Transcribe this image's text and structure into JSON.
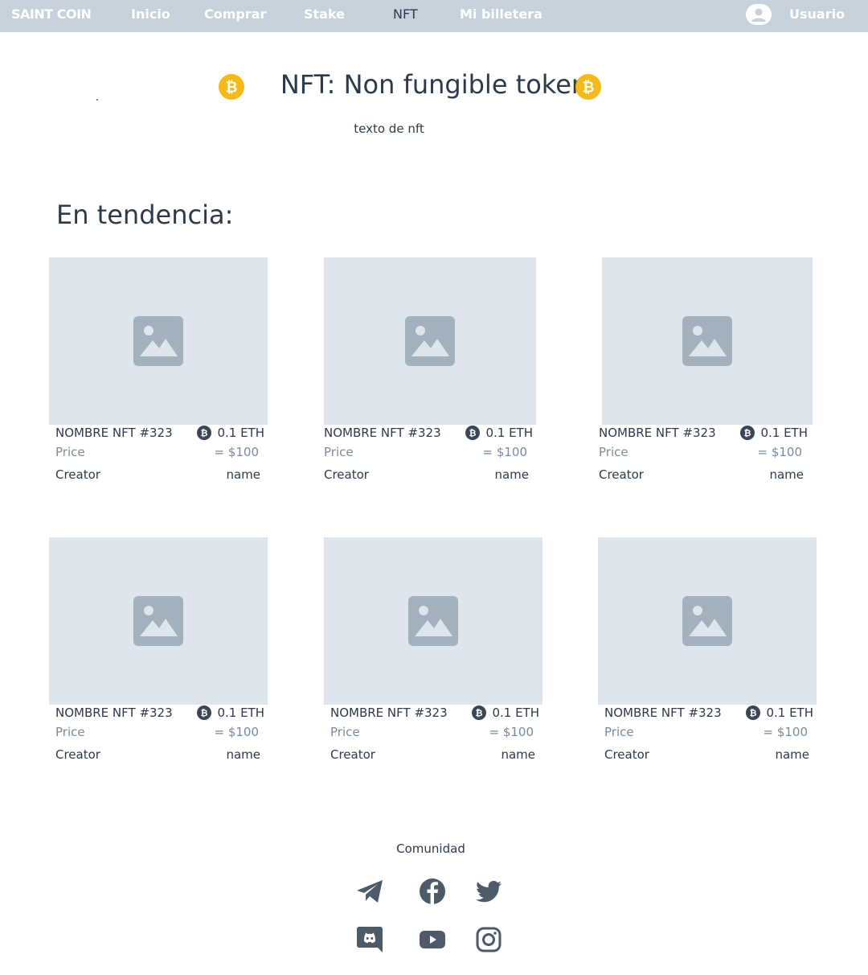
{
  "nav": {
    "brand": "SAINT COIN",
    "items": [
      "Inicio",
      "Comprar",
      "Stake",
      "NFT",
      "Mi billetera"
    ],
    "active": "NFT",
    "user_label": "Usuario"
  },
  "hero": {
    "title": "NFT: Non fungible token",
    "subtitle": "texto de nft"
  },
  "trending": {
    "title": "En tendencia:",
    "cards": [
      {
        "name": "NOMBRE NFT #323",
        "eth": "0.1 ETH",
        "price_label": "Price",
        "usd": "= $100",
        "creator_label": "Creator",
        "creator": "name"
      },
      {
        "name": "NOMBRE NFT #323",
        "eth": "0.1 ETH",
        "price_label": "Price",
        "usd": "= $100",
        "creator_label": "Creator",
        "creator": "name"
      },
      {
        "name": "NOMBRE NFT #323",
        "eth": "0.1 ETH",
        "price_label": "Price",
        "usd": "= $100",
        "creator_label": "Creator",
        "creator": "name"
      },
      {
        "name": "NOMBRE NFT #323",
        "eth": "0.1 ETH",
        "price_label": "Price",
        "usd": "= $100",
        "creator_label": "Creator",
        "creator": "name"
      },
      {
        "name": "NOMBRE NFT #323",
        "eth": "0.1 ETH",
        "price_label": "Price",
        "usd": "= $100",
        "creator_label": "Creator",
        "creator": "name"
      },
      {
        "name": "NOMBRE NFT #323",
        "eth": "0.1 ETH",
        "price_label": "Price",
        "usd": "= $100",
        "creator_label": "Creator",
        "creator": "name"
      }
    ]
  },
  "footer": {
    "title": "Comunidad",
    "socials": [
      "telegram-icon",
      "facebook-icon",
      "twitter-icon",
      "discord-icon",
      "youtube-icon",
      "instagram-icon"
    ]
  },
  "colors": {
    "nav_bg": "#c7d1db",
    "coin": "#f4b91a",
    "image_placeholder": "#dfe5ec",
    "icon_gray": "#a3b1bd",
    "text_dark": "#2d3a4a",
    "text_muted": "#7a8a9c",
    "social_icon": "#4d5a68"
  }
}
